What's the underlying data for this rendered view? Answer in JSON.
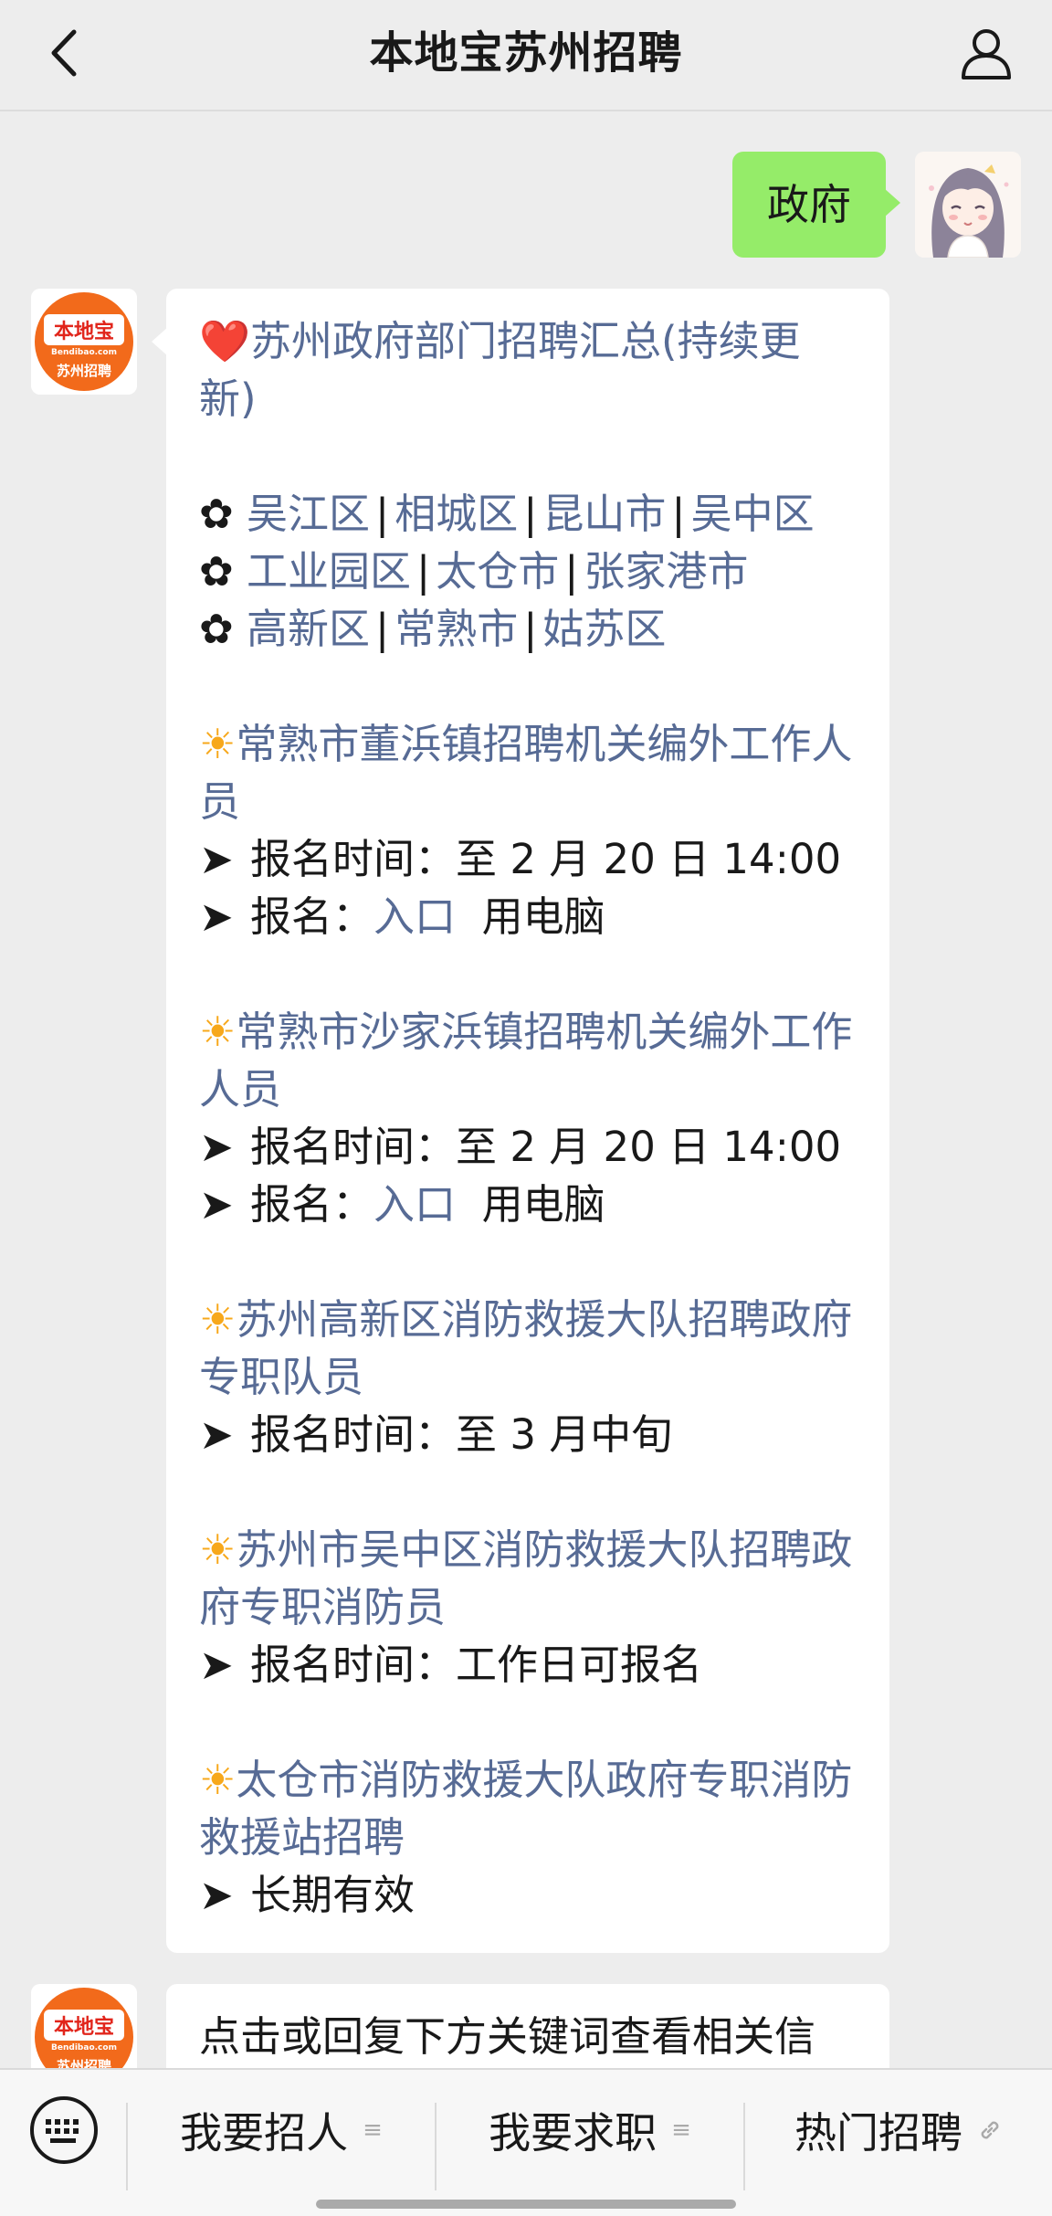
{
  "header": {
    "title": "本地宝苏州招聘",
    "back_icon": "chevron-left-icon",
    "profile_icon": "person-icon"
  },
  "user_message": {
    "text": "政府"
  },
  "bot_avatar": {
    "brand": "本地宝",
    "domain": "Bendibao.com",
    "sub": "苏州招聘"
  },
  "main_message": {
    "heading_emoji": "❤️",
    "heading": "苏州政府部门招聘汇总(持续更新)",
    "district_rows": [
      [
        "吴江区",
        "相城区",
        "昆山市",
        "吴中区"
      ],
      [
        "工业园区",
        "太仓市",
        "张家港市"
      ],
      [
        "高新区",
        "常熟市",
        "姑苏区"
      ]
    ],
    "flower": "✿",
    "separator": "|",
    "items": [
      {
        "title": "常熟市董浜镇招聘机关编外工作人员",
        "lines": [
          {
            "prefix": "报名时间：",
            "text": "至 2 月 20 日 14:00"
          },
          {
            "prefix": "报名：",
            "link": "入口",
            "suffix": "  用电脑"
          }
        ]
      },
      {
        "title": "常熟市沙家浜镇招聘机关编外工作人员",
        "lines": [
          {
            "prefix": "报名时间：",
            "text": "至 2 月 20 日 14:00"
          },
          {
            "prefix": "报名：",
            "link": "入口",
            "suffix": "  用电脑"
          }
        ]
      },
      {
        "title": "苏州高新区消防救援大队招聘政府专职队员",
        "lines": [
          {
            "prefix": "报名时间：",
            "text": "至 3 月中旬"
          }
        ]
      },
      {
        "title": "苏州市吴中区消防救援大队招聘政府专职消防员",
        "lines": [
          {
            "prefix": "报名时间：",
            "text": "工作日可报名"
          }
        ]
      },
      {
        "title": "太仓市消防救援大队政府专职消防救援站招聘",
        "lines": [
          {
            "prefix": "",
            "text": "长期有效"
          }
        ]
      }
    ],
    "arrow": "➤",
    "sun": "☀"
  },
  "second_message": {
    "text": "点击或回复下方关键词查看相关信"
  },
  "bottom_menu": {
    "keyboard_icon": "keyboard-icon",
    "items": [
      {
        "label": "我要招人",
        "icon": "≡"
      },
      {
        "label": "我要求职",
        "icon": "≡"
      },
      {
        "label": "热门招聘",
        "icon": "🔗"
      }
    ]
  }
}
